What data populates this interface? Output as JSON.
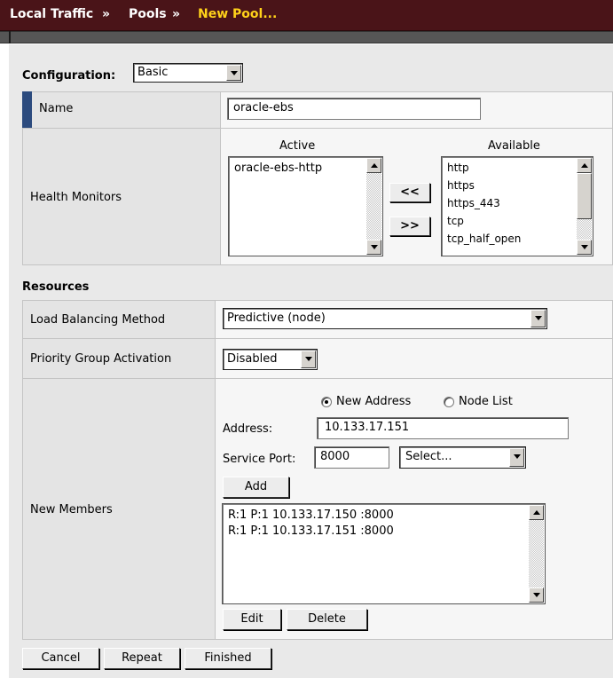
{
  "breadcrumb": {
    "items": [
      "Local Traffic",
      "»",
      "Pools",
      "»"
    ],
    "current": "New Pool..."
  },
  "configuration": {
    "label": "Configuration:",
    "value": "Basic"
  },
  "name_row": {
    "label": "Name",
    "value": "oracle-ebs"
  },
  "health": {
    "label": "Health Monitors",
    "active_header": "Active",
    "available_header": "Available",
    "active_items": [
      "oracle-ebs-http"
    ],
    "available_items": [
      "http",
      "https",
      "https_443",
      "tcp",
      "tcp_half_open"
    ],
    "add_btn": "<<",
    "remove_btn": ">>"
  },
  "resources": {
    "header": "Resources",
    "lb_method": {
      "label": "Load Balancing Method",
      "value": "Predictive (node)"
    },
    "priority": {
      "label": "Priority Group Activation",
      "value": "Disabled"
    },
    "members": {
      "label": "New Members",
      "radio_new": "New Address",
      "radio_node": "Node List",
      "address_label": "Address:",
      "address_value": "10.133.17.151",
      "port_label": "Service Port:",
      "port_value": "8000",
      "port_select": "Select...",
      "add_btn": "Add",
      "list": [
        "R:1 P:1 10.133.17.150 :8000",
        "R:1 P:1 10.133.17.151 :8000"
      ],
      "edit_btn": "Edit",
      "delete_btn": "Delete"
    }
  },
  "footer": {
    "cancel": "Cancel",
    "repeat": "Repeat",
    "finished": "Finished"
  },
  "colors": {
    "header_bg": "#4a1418",
    "current_crumb": "#ffd21a",
    "name_marker": "#2c4b7e"
  }
}
